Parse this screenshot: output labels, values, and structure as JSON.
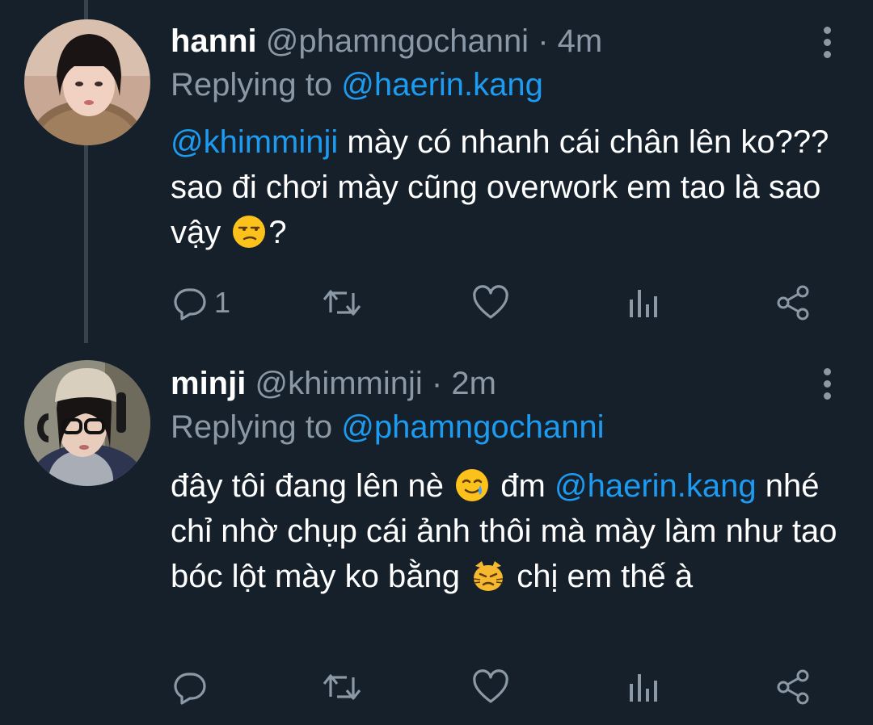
{
  "tweets": [
    {
      "name": "hanni",
      "handle": "@phamngochanni",
      "dot": "·",
      "time": "4m",
      "replying_label": "Replying to",
      "replying_to": "@haerin.kang",
      "text": {
        "mention": "@khimminji",
        "part1": " mày có nhanh cái chân lên ko??? sao đi chơi mày cũng overwork em tao là sao vậy ",
        "emoji1": "unamused-face",
        "part2": "?"
      },
      "actions": {
        "reply_count": "1",
        "retweet_count": "",
        "like_count": ""
      }
    },
    {
      "name": "minji",
      "handle": "@khimminji",
      "dot": "·",
      "time": "2m",
      "replying_label": "Replying to",
      "replying_to": "@phamngochanni",
      "text": {
        "part1": "đây tôi đang lên nè ",
        "emoji1": "smiling-face-with-tear",
        "part2": " đm ",
        "mention": "@haerin.kang",
        "part3": " nhé chỉ nhờ chụp cái ảnh thôi mà mày làm như tao bóc lột mày ko bằng ",
        "emoji2": "pouting-cat-face",
        "part4": " chị em thế à"
      },
      "actions": {
        "reply_count": "",
        "retweet_count": "",
        "like_count": ""
      }
    }
  ],
  "colors": {
    "background": "#15202b",
    "text": "#ffffff",
    "secondary": "#8b98a5",
    "accent": "#1d9bf0",
    "thread_line": "#38444d"
  },
  "icons": [
    "more-vertical-icon",
    "reply-icon",
    "retweet-icon",
    "like-icon",
    "analytics-icon",
    "share-icon"
  ]
}
